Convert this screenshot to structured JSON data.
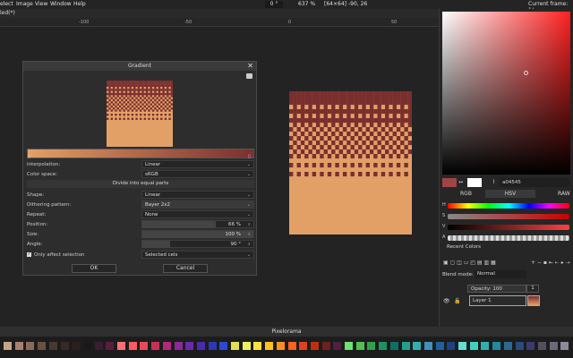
{
  "menu": [
    "elect",
    "Image",
    "View",
    "Window",
    "Help"
  ],
  "toolbar": {
    "rotation": "0 °",
    "zoom": "637 %",
    "size": "[64×64]",
    "cursor": "-90, 26"
  },
  "current_frame": "Current frame: 1/",
  "tab_label": "led(*)",
  "ruler_marks": [
    "-100",
    "-50",
    "0",
    "50"
  ],
  "dialog": {
    "title": "Gradient",
    "interpolation_label": "Interpolation:",
    "interpolation": "Linear",
    "colorspace_label": "Color space:",
    "colorspace": "sRGB",
    "divide_label": "Divide into equal parts",
    "shape_label": "Shape:",
    "shape": "Linear",
    "dither_label": "Dithering pattern:",
    "dither": "Bayer 2x2",
    "repeat_label": "Repeat:",
    "repeat": "None",
    "position_label": "Position:",
    "position": "66 %",
    "position_frac": 0.66,
    "size_label": "Size:",
    "size": "100 %",
    "size_frac": 1.0,
    "angle_label": "Angle:",
    "angle": "90 °",
    "angle_frac": 0.25,
    "only_affect_label": "Only affect selection",
    "affect": "Selected cels",
    "ok": "OK",
    "cancel": "Cancel"
  },
  "color_panel": {
    "hex": "a04545",
    "tabs": [
      "RGB",
      "HSV",
      "RAW"
    ],
    "slider_labels": [
      "H",
      "S",
      "V",
      "A"
    ],
    "recent_colors": "Recent Colors"
  },
  "layers": {
    "blend_label": "Blend mode:",
    "blend": "Normal",
    "opacity": "Opacity: 100",
    "layer_name": "Layer 1",
    "frame_num": "1"
  },
  "status": "Pixelorama",
  "colors": {
    "primary": "#a04545",
    "secondary": "#ffffff",
    "grad_start": "#e3a066",
    "grad_end": "#7a2f2f"
  },
  "palette": [
    "#c8a38a",
    "#a88070",
    "#8a6a5a",
    "#6a5040",
    "#4a3830",
    "#382a26",
    "#2a2020",
    "#1c1818",
    "#3a1e30",
    "#5a1e3a",
    "#ff7070",
    "#ff5a5a",
    "#e84a5a",
    "#c8305a",
    "#b02a7a",
    "#8a2a9a",
    "#6a2aaa",
    "#4a2ab0",
    "#2a3ab0",
    "#2a4ad0",
    "#e0e050",
    "#f0f060",
    "#ffe040",
    "#ffc020",
    "#ff9020",
    "#ff6020",
    "#e04020",
    "#c03010",
    "#702020",
    "#502040",
    "#70e070",
    "#50c050",
    "#30a050",
    "#209060",
    "#107060",
    "#20a090",
    "#30b0b0",
    "#4090c0",
    "#2060a0",
    "#204080",
    "#60e0d0",
    "#40d0c0",
    "#30b0b0",
    "#208aa0",
    "#2a6a90",
    "#2a4a80",
    "#3a3a70",
    "#505060",
    "#6a6a7a",
    "#8a8a9a"
  ]
}
